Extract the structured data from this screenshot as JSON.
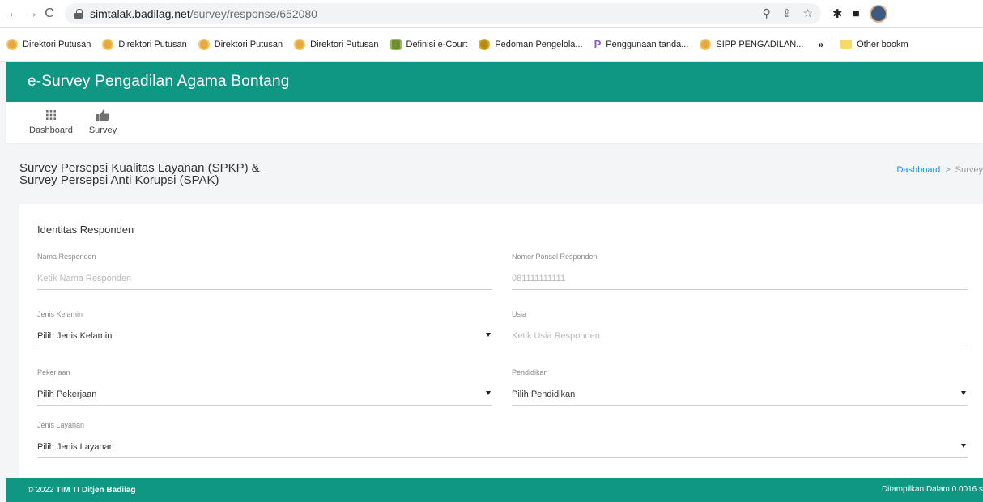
{
  "browser": {
    "url_host": "simtalak.badilag.net",
    "url_path": "/survey/response/652080",
    "bookmarks": [
      {
        "label": "Direktori Putusan",
        "icon": "ma-logo-icon"
      },
      {
        "label": "Direktori Putusan",
        "icon": "ma-logo-icon"
      },
      {
        "label": "Direktori Putusan",
        "icon": "ma-logo-icon"
      },
      {
        "label": "Direktori Putusan",
        "icon": "ma-logo-icon"
      },
      {
        "label": "Definisi e-Court",
        "icon": "ecourt-logo-icon"
      },
      {
        "label": "Pedoman Pengelola...",
        "icon": "pa-logo-icon"
      },
      {
        "label": "Penggunaan tanda...",
        "icon": "p-logo-icon"
      },
      {
        "label": "SIPP PENGADILAN...",
        "icon": "ma-logo-icon"
      }
    ],
    "more_bookmarks": "»",
    "other_bookmarks": "Other bookm"
  },
  "header": {
    "title": "e-Survey Pengadilan Agama Bontang",
    "color": "#0f9784"
  },
  "menu": {
    "items": [
      {
        "label": "Dashboard",
        "icon": "grid-icon"
      },
      {
        "label": "Survey",
        "icon": "thumbs-up-icon"
      }
    ]
  },
  "page": {
    "title_line1": "Survey Persepsi Kualitas Layanan (SPKP) &",
    "title_line2": "Survey Persepsi Anti Korupsi (SPAK)",
    "breadcrumb": {
      "home": "Dashboard",
      "separator": ">",
      "current": "Survey"
    }
  },
  "form": {
    "section_title": "Identitas Responden",
    "nama": {
      "label": "Nama Responden",
      "placeholder": "Ketik Nama Responden"
    },
    "ponsel": {
      "label": "Nomor Ponsel Responden",
      "placeholder": "081111111111"
    },
    "jenis_kelamin": {
      "label": "Jenis Kelamin",
      "value": "Pilih Jenis Kelamin"
    },
    "usia": {
      "label": "Usia",
      "placeholder": "Ketik Usia Responden"
    },
    "pekerjaan": {
      "label": "Pekerjaan",
      "value": "Pilih Pekerjaan"
    },
    "pendidikan": {
      "label": "Pendidikan",
      "value": "Pilih Pendidikan"
    },
    "jenis_layanan": {
      "label": "Jenis Layanan",
      "value": "Pilih Jenis Layanan"
    }
  },
  "footer": {
    "copyright": "© 2022",
    "org": "TIM TI Ditjen Badilag",
    "render_time": "Ditampilkan Dalam 0.0016 s"
  }
}
